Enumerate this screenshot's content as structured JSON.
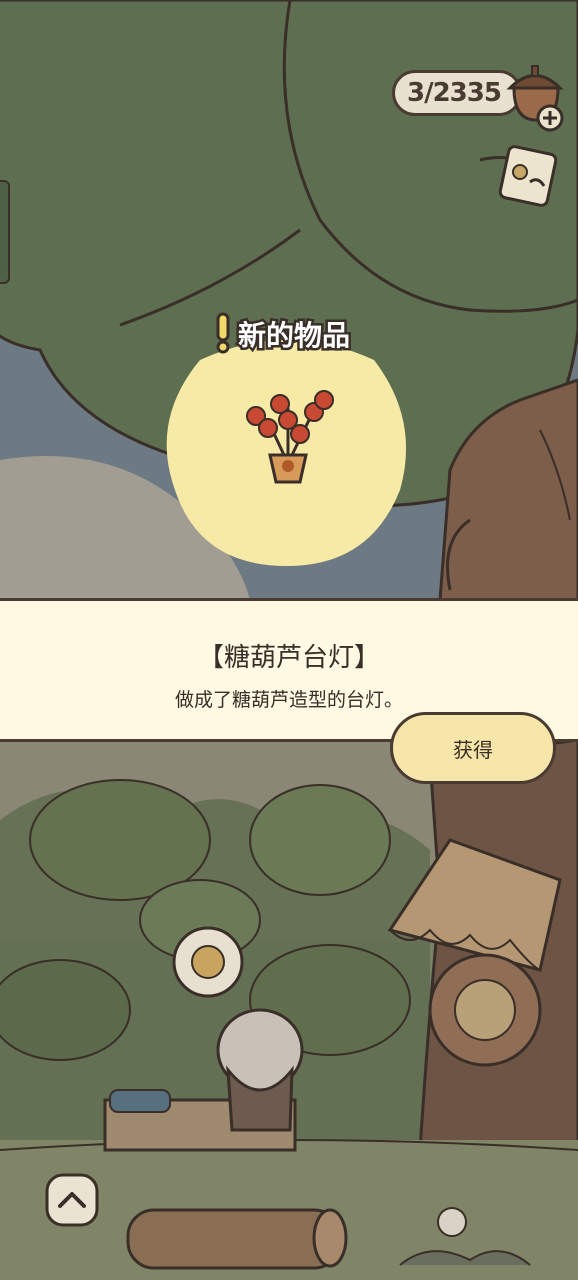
{
  "hud": {
    "acorn_count": "3/2335"
  },
  "popup": {
    "header_label": "新的物品",
    "item_name": "【糖葫芦台灯】",
    "item_description": "做成了糖葫芦造型的台灯。",
    "obtain_button_label": "获得"
  },
  "icons": {
    "acorn": "acorn-icon",
    "add": "plus-icon",
    "note": "notebook-icon",
    "up": "chevron-up-icon",
    "yarn": "yarn-ball-icon"
  }
}
